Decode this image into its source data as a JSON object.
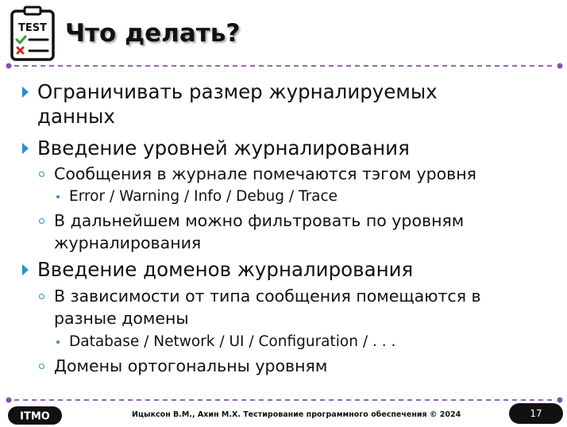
{
  "header": {
    "logo_label": "TEST",
    "title": "Что делать?"
  },
  "items": [
    {
      "level": 1,
      "lines": [
        "Ограничивать размер журналируемых",
        "данных"
      ]
    },
    {
      "level": 1,
      "lines": [
        "Введение уровней журналирования"
      ]
    },
    {
      "level": 2,
      "lines": [
        "Сообщения в журнале помечаются тэгом уровня"
      ]
    },
    {
      "level": 3,
      "lines": [
        "Error / Warning / Info / Debug / Trace"
      ]
    },
    {
      "level": 2,
      "lines": [
        "В дальнейшем можно фильтровать по уровням",
        "журналирования"
      ]
    },
    {
      "level": 1,
      "lines": [
        "Введение доменов журналирования"
      ]
    },
    {
      "level": 2,
      "lines": [
        "В зависимости от типа сообщения помещаются в",
        "разные домены"
      ]
    },
    {
      "level": 3,
      "lines": [
        "Database / Network / UI / Configuration / . . ."
      ]
    },
    {
      "level": 2,
      "lines": [
        "Домены ортогональны уровням"
      ]
    }
  ],
  "footer": {
    "brand": "ITMO",
    "credits": "Ицыксон В.М., Ахин М.Х. Тестирование программного обеспечения © 2024",
    "page": "17"
  },
  "colors": {
    "accent": "#2a8fd0",
    "rule": "#8a4fb0",
    "text": "#111111",
    "check": "#2e9e3a",
    "cross": "#d42a2a"
  }
}
